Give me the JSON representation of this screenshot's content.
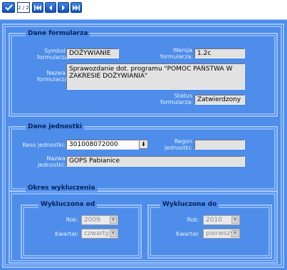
{
  "toolbar": {
    "pager": "2 / 2",
    "icons": [
      "check-icon",
      "first-icon",
      "previous-icon",
      "next-icon",
      "last-icon"
    ]
  },
  "form": {
    "section_title": "Dane formularza",
    "symbol_label_1": "Symbol",
    "symbol_label_2": "formularza:",
    "symbol_value": "DOŻYWIANIE",
    "version_label_1": "Wersja",
    "version_label_2": "formularza:",
    "version_value": "1.2c",
    "name_label_1": "Nazwa",
    "name_label_2": "formularza:",
    "name_value": "Sprawozdanie dot. programu \"POMOC PAŃSTWA W ZAKRESIE DOŻYWIANIA\"",
    "status_label_1": "Status",
    "status_label_2": "formularza:",
    "status_value": "Zatwierdzony"
  },
  "unit": {
    "section_title": "Dane jednostki",
    "keso_label": "Keso jednostki:",
    "keso_value": "301008072000",
    "regon_label_1": "Regon",
    "regon_label_2": "jednostki:",
    "regon_value": "",
    "name_label_1": "Nazwa",
    "name_label_2": "jednostki:",
    "name_value": "GOPS Pabianice"
  },
  "exclusion": {
    "section_title": "Okres wykluczenia",
    "from": {
      "title": "Wykluczona od",
      "year_label": "Rok:",
      "year_value": "2009",
      "quarter_label": "Kwartał:",
      "quarter_value": "czwarty"
    },
    "to": {
      "title": "Wykluczona do",
      "year_label": "Rok:",
      "year_value": "2010",
      "quarter_label": "Kwartał:",
      "quarter_value": "pierwszy"
    }
  },
  "colors": {
    "panel": "#4e8dea",
    "frame": "#9cc4ff",
    "legend_text": "#06215a",
    "toolbar_button": "#1f62cc"
  }
}
